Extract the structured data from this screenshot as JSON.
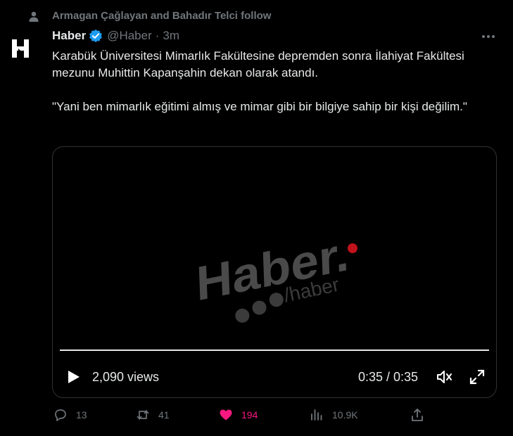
{
  "social_context": "Armagan Çağlayan and Bahadır Telci follow",
  "tweet": {
    "author_name": "Haber",
    "handle": "@Haber",
    "separator": "·",
    "time": "3m",
    "text_line1": "Karabük Üniversitesi Mimarlık Fakültesine depremden sonra İlahiyat Fakültesi mezunu Muhittin Kapanşahin dekan olarak atandı.",
    "text_line2": "\"Yani ben mimarlık eğitimi almış ve mimar gibi bir bilgiye sahip bir kişi değilim.\""
  },
  "video": {
    "watermark_logo": "Haber.",
    "watermark_handle": "/haber",
    "views": "2,090 views",
    "duration": "0:35 / 0:35",
    "progress": 1.0
  },
  "actions": {
    "reply_count": "13",
    "retweet_count": "41",
    "like_count": "194",
    "view_count": "10.9K"
  },
  "colors": {
    "background": "#000000",
    "text": "#e7e9ea",
    "muted": "#71767b",
    "verified": "#1d9bf0",
    "like": "#f91880",
    "watermark_dot": "#c0121a"
  }
}
